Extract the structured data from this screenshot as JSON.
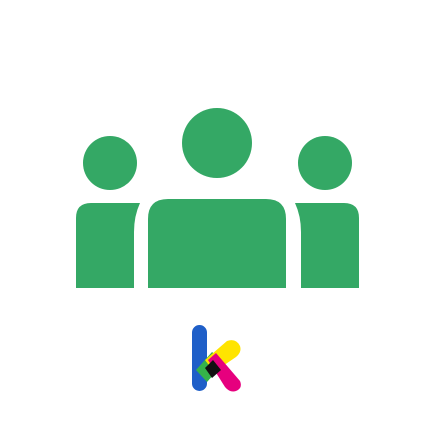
{
  "icon": {
    "primary_color": "#34A865",
    "background_color": "#FFFFFF",
    "glyph": "people-group-icon",
    "brand_mark": "k-logo-icon",
    "brand_colors": [
      "#1F5FC8",
      "#35B34A",
      "#FFE400",
      "#E6007E",
      "#111111"
    ]
  }
}
